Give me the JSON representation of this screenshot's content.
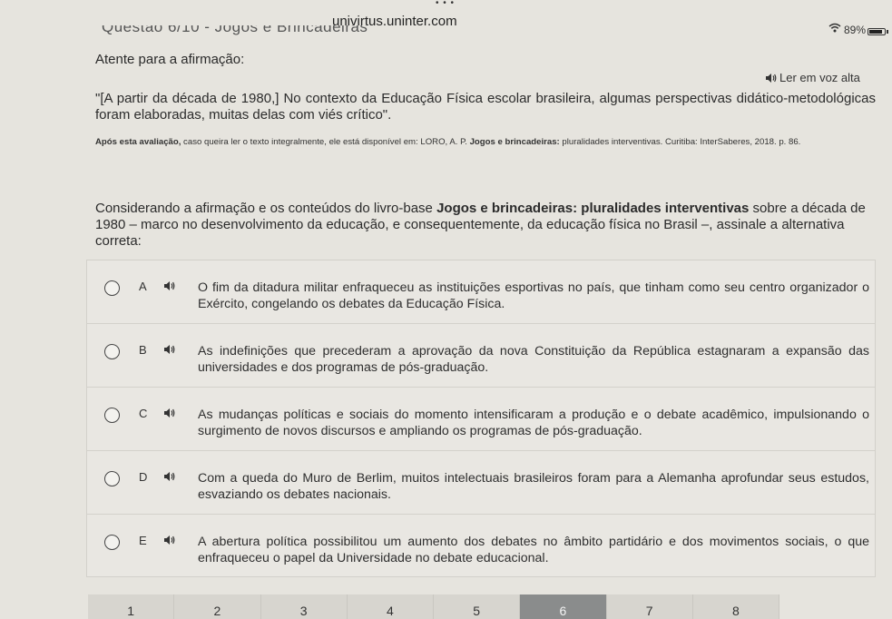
{
  "browser": {
    "url": "univirtus.uninter.com",
    "truncated_title": "Questão 6/10 - Jogos e Brincadeiras",
    "battery_percent": "89%",
    "battery_level": 0.89
  },
  "question": {
    "instruction": "Atente para a afirmação:",
    "read_aloud_label": "Ler em voz alta",
    "quote": "\"[A partir da década de 1980,] No contexto da Educação Física escolar brasileira, algumas perspectivas didático-metodológicas foram elaboradas, muitas delas com viés crítico\".",
    "source_intro_bold": "Após esta avaliação,",
    "source_intro": " caso queira ler o texto integralmente, ele está disponível em: LORO, A. P. ",
    "source_title_bold": "Jogos e brincadeiras:",
    "source_rest": " pluralidades interventivas. Curitiba: InterSaberes, 2018. p. 86.",
    "statement_start": "Considerando a afirmação e os conteúdos do livro-base ",
    "statement_bold": "Jogos e brincadeiras: pluralidades interventivas",
    "statement_end": " sobre a década de 1980 – marco no desenvolvimento da educação, e consequentemente, da educação física no Brasil –, assinale a alternativa correta:"
  },
  "options": [
    {
      "letter": "A",
      "text": "O fim da ditadura militar enfraqueceu as instituições esportivas no país, que tinham como seu centro organizador o Exército, congelando os debates da Educação Física."
    },
    {
      "letter": "B",
      "text": "As indefinições que precederam a aprovação da nova Constituição da República estagnaram a expansão das universidades e dos programas de pós-graduação."
    },
    {
      "letter": "C",
      "text": "As mudanças políticas e sociais do momento intensificaram a produção e o debate acadêmico, impulsionando o surgimento de novos discursos e ampliando os programas de pós-graduação."
    },
    {
      "letter": "D",
      "text": "Com a queda do Muro de Berlim, muitos intelectuais brasileiros foram para a Alemanha aprofundar seus estudos, esvaziando os debates nacionais."
    },
    {
      "letter": "E",
      "text": "A abertura política possibilitou um aumento dos debates no âmbito partidário e dos movimentos sociais, o que enfraqueceu o papel da Universidade no debate educacional."
    }
  ],
  "pagination": {
    "pages": [
      "1",
      "2",
      "3",
      "4",
      "5",
      "6",
      "7",
      "8"
    ],
    "active_page": "6"
  },
  "icons": {
    "speaker": "speaker-icon",
    "wifi": "wifi-icon",
    "battery": "battery-icon"
  }
}
